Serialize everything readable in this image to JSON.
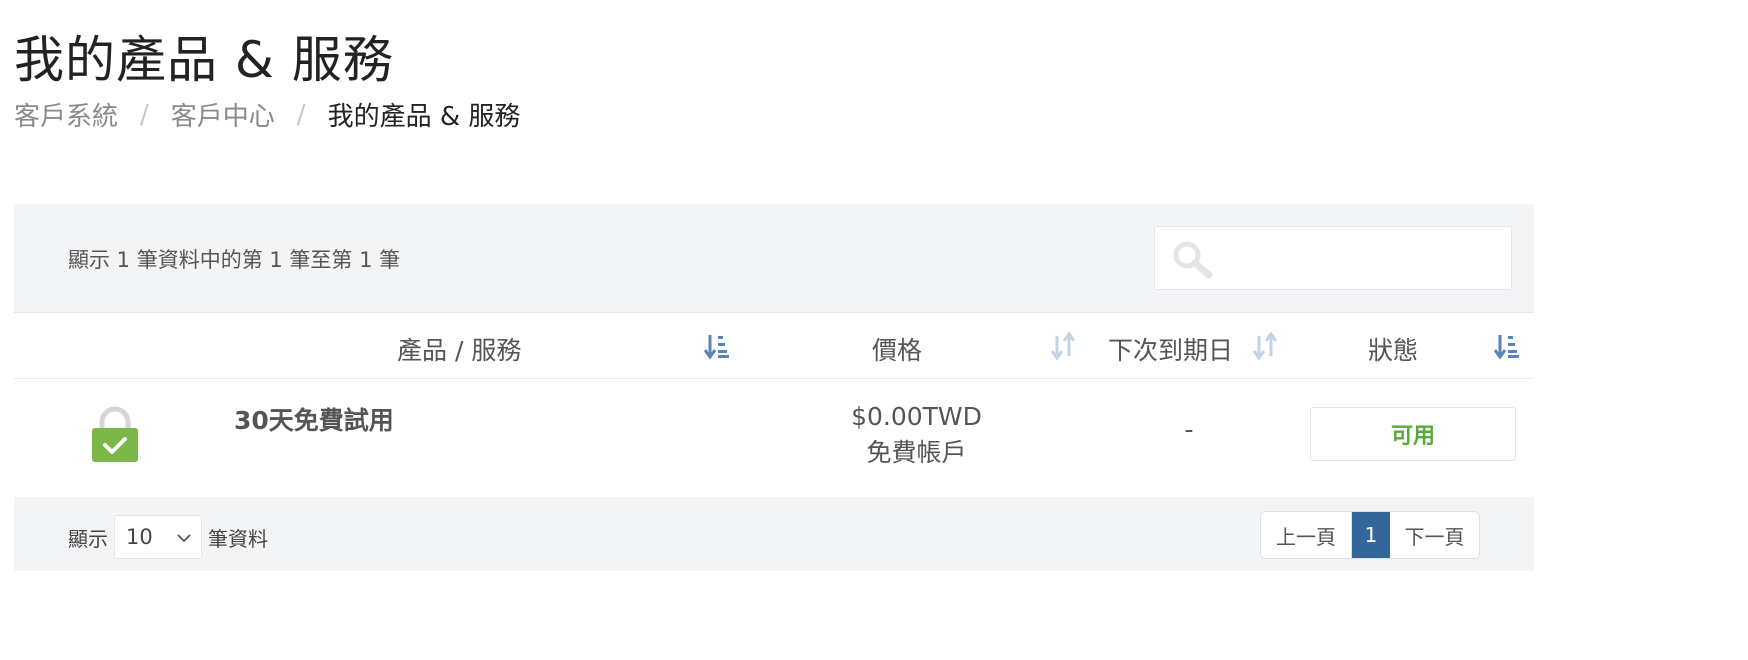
{
  "page": {
    "title": "我的產品 & 服務"
  },
  "breadcrumb": {
    "items": [
      "客戶系統",
      "客戶中心",
      "我的產品 & 服務"
    ],
    "separator": "/"
  },
  "table": {
    "info": "顯示 1 筆資料中的第 1 筆至第 1 筆",
    "search": {
      "value": "",
      "icon": "search-icon"
    },
    "columns": [
      {
        "label": "產品 / 服務",
        "sort": "sorted-descending"
      },
      {
        "label": "價格",
        "sort": "sortable"
      },
      {
        "label": "下次到期日",
        "sort": "sortable"
      },
      {
        "label": "狀態",
        "sort": "sorted-descending"
      }
    ],
    "rows": [
      {
        "icon": "lock-check-icon",
        "product": "30天免費試用",
        "price": "$0.00TWD",
        "billing": "免費帳戶",
        "next_due": "-",
        "status": "可用"
      }
    ]
  },
  "footer": {
    "show_label": "顯示",
    "page_length": "10",
    "records_label": "筆資料",
    "pagination": {
      "prev": "上一頁",
      "current": "1",
      "next": "下一頁"
    }
  },
  "colors": {
    "accent": "#336699",
    "status_active": "#5aaa3a",
    "lock_green": "#7ab648",
    "panel_bg": "#f3f4f6"
  }
}
